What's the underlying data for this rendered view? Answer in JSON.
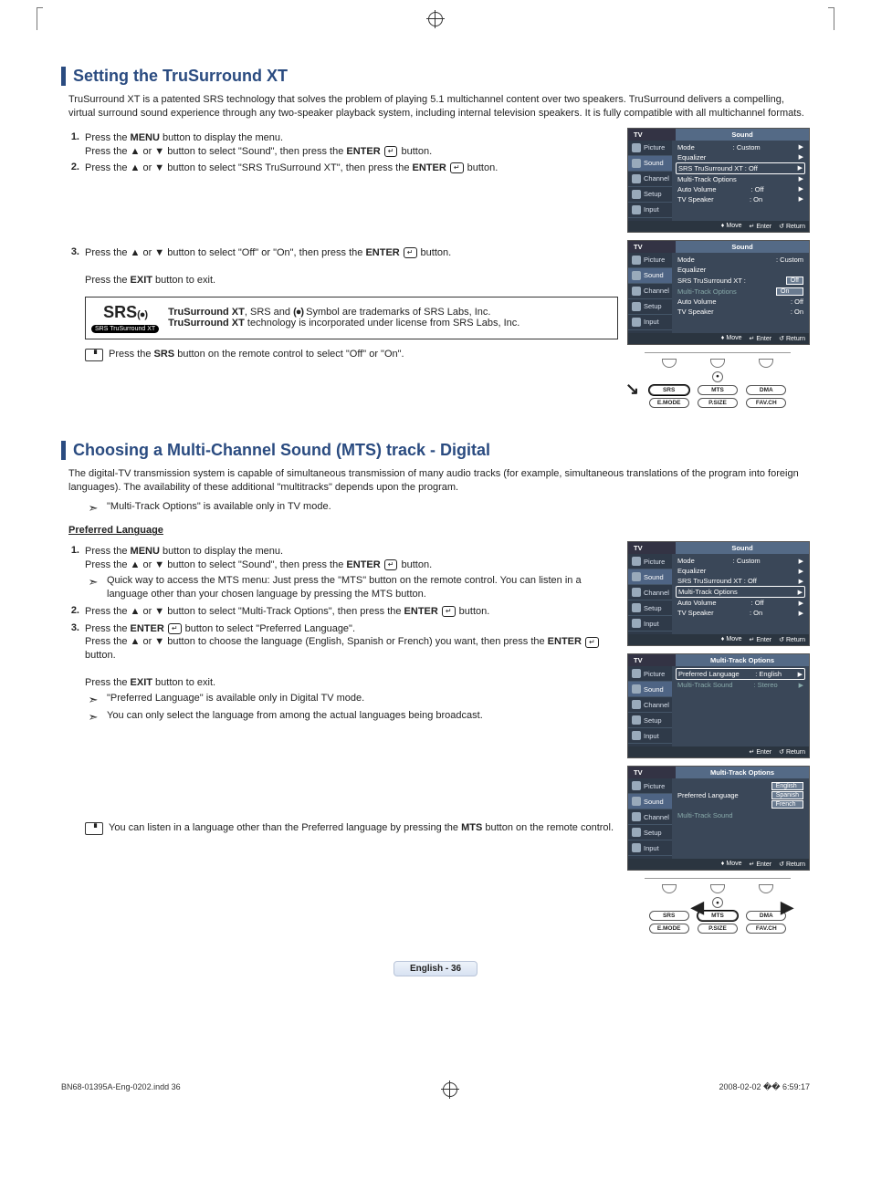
{
  "sec1": {
    "title": "Setting the TruSurround XT",
    "intro": "TruSurround XT is a patented SRS technology that solves the problem of playing 5.1 multichannel content over two speakers. TruSurround delivers a compelling, virtual surround sound experience through any two-speaker playback system, including internal television speakers. It is fully compatible with all multichannel formats.",
    "step1a": "Press the ",
    "step1b": " button to display the menu.",
    "step1c": "Press the ▲ or ▼ button to select \"Sound\", then press the ",
    "step1d": " button.",
    "step2a": "Press the ▲ or ▼ button to select \"SRS TruSurround XT\", then press the ",
    "step2b": " button.",
    "step3a": "Press the ▲ or ▼ button to select \"Off\" or \"On\", then press the ",
    "step3b": " button.",
    "step3c": "Press the ",
    "step3d": " button to exit.",
    "srs_note_a": "TruSurround XT",
    "srs_note_b": ", SRS and ",
    "srs_note_c": " Symbol are trademarks of SRS Labs, Inc.",
    "srs_note_d": "TruSurround XT",
    "srs_note_e": " technology is incorporated under license from SRS Labs, Inc.",
    "srs_logo_big": "SRS",
    "srs_logo_sub": "SRS TruSurround XT",
    "remote_tip_a": "Press the ",
    "remote_tip_b": " button on the remote control to select \"Off\" or \"On\"."
  },
  "sec2": {
    "title": "Choosing a Multi-Channel Sound (MTS) track - Digital",
    "intro": "The digital-TV transmission system is capable of simultaneous transmission of many audio tracks (for example, simultaneous translations of the program into foreign languages). The availability of these additional \"multitracks\" depends upon the program.",
    "note1": "\"Multi-Track Options\" is available only in TV mode.",
    "subheader": "Preferred Language",
    "s1a": "Press the ",
    "s1b": " button to display the menu.",
    "s1c": "Press the ▲ or ▼ button to select \"Sound\", then press the ",
    "s1d": " button.",
    "s1tip": "Quick way to access the MTS menu: Just press the \"MTS\" button on the remote control. You can listen in a language other than your chosen language by pressing the MTS button.",
    "s2a": "Press the ▲ or ▼ button to select \"Multi-Track Options\", then press the ",
    "s2b": " button.",
    "s3a": "Press the ",
    "s3b": " button to select \"Preferred Language\".",
    "s3c": "Press the ▲ or ▼ button to choose the language (English, Spanish or French) you want, then press the ",
    "s3d": " button.",
    "s3e": "Press the ",
    "s3f": " button to exit.",
    "s3tip1": "\"Preferred Language\" is available only in Digital TV mode.",
    "s3tip2": "You can only select the language from among the actual languages being broadcast.",
    "remote_tip_a": "You can listen in a language other than the Preferred language by pressing the ",
    "remote_tip_b": " button on the remote control."
  },
  "kw": {
    "menu": "MENU",
    "enter": "ENTER",
    "exit": "EXIT",
    "srs": "SRS",
    "mts": "MTS"
  },
  "osd": {
    "tv": "TV",
    "title_sound": "Sound",
    "title_mto": "Multi-Track Options",
    "nav": {
      "picture": "Picture",
      "sound": "Sound",
      "channel": "Channel",
      "setup": "Setup",
      "input": "Input"
    },
    "mode": "Mode",
    "mode_v": ": Custom",
    "eq": "Equalizer",
    "srs": "SRS TruSurround XT : Off",
    "srs_label": "SRS TruSurround XT :",
    "mto": "Multi-Track Options",
    "av": "Auto Volume",
    "av_v": ": Off",
    "tvsp": "TV Speaker",
    "tvsp_v": ": On",
    "off": "Off",
    "on": "On",
    "pref": "Preferred Language",
    "pref_v": ": English",
    "mtsnd": "Multi-Track Sound",
    "mtsnd_v": ": Stereo",
    "eng": "English",
    "spa": "Spanish",
    "fre": "French",
    "move": "Move",
    "enter": "Enter",
    "return": "Return"
  },
  "remote": {
    "srs": "SRS",
    "mts": "MTS",
    "dma": "DMA",
    "emode": "E.MODE",
    "psize": "P.SIZE",
    "favch": "FAV.CH"
  },
  "page_badge": "English - 36",
  "footer": {
    "left": "BN68-01395A-Eng-0202.indd   36",
    "right": "2008-02-02   �� 6:59:17"
  }
}
